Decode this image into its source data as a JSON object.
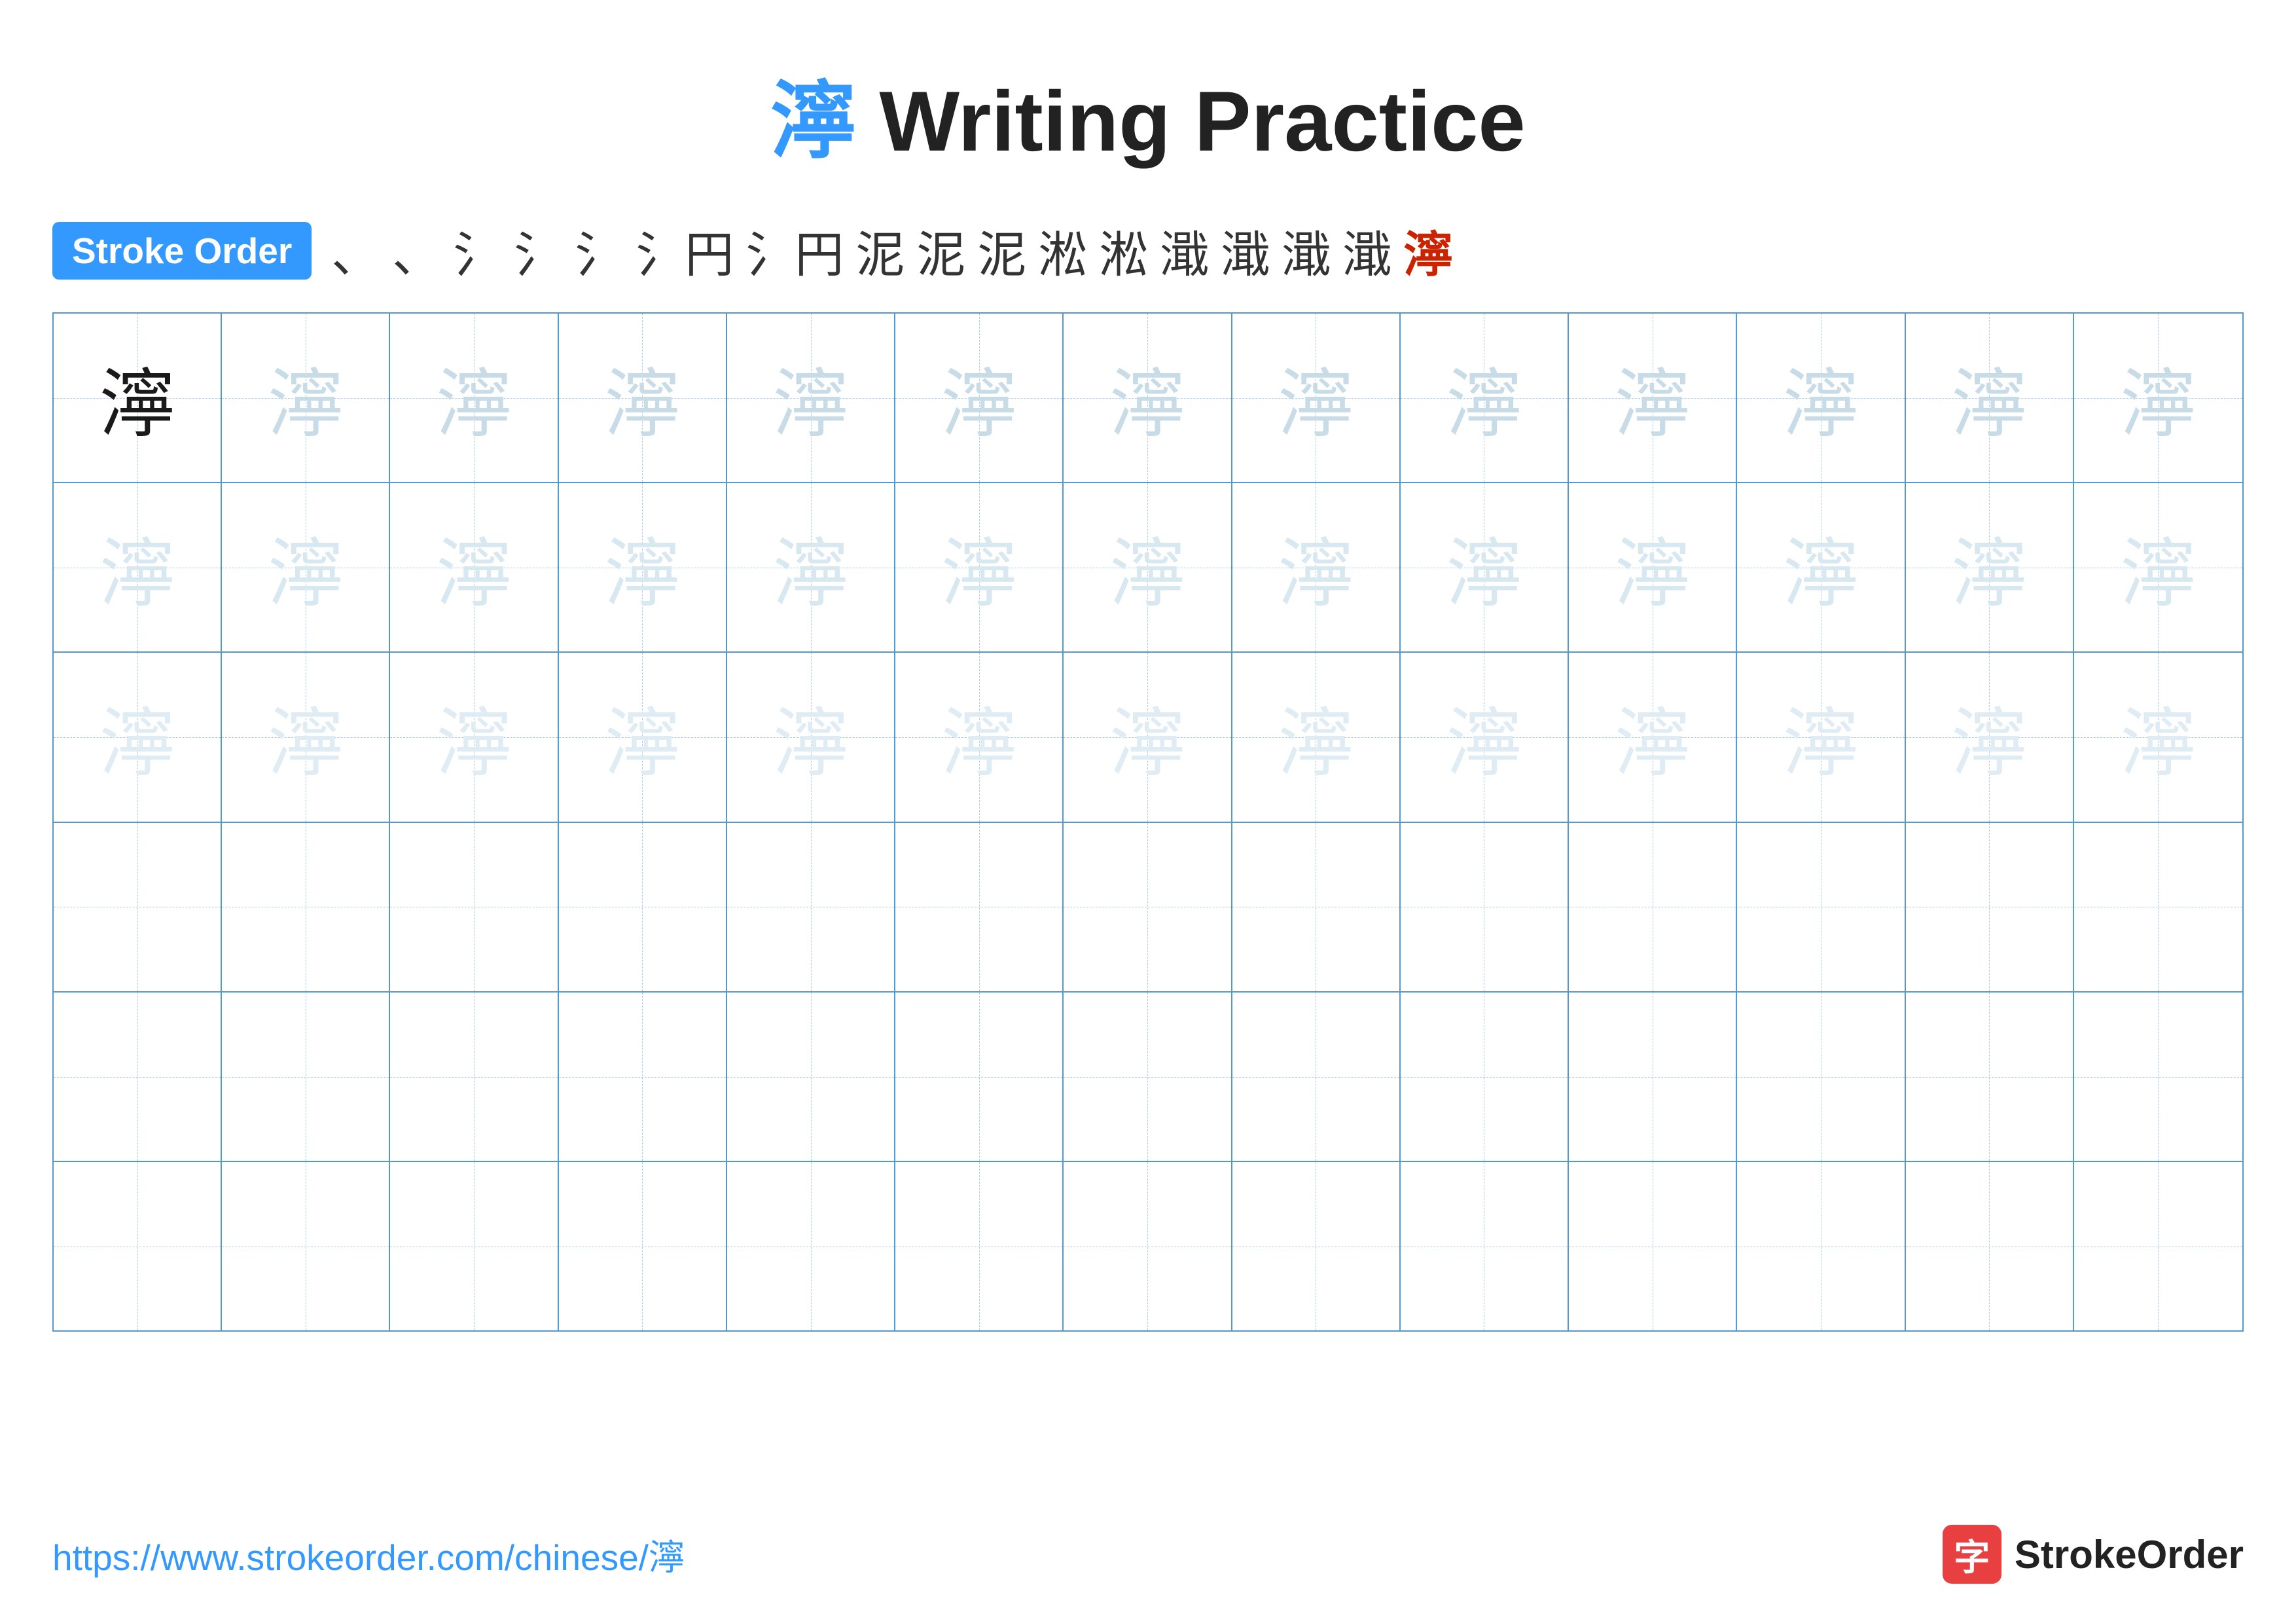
{
  "title": {
    "char": "濘",
    "text": " Writing Practice"
  },
  "stroke_order": {
    "badge_label": "Stroke Order",
    "steps": [
      "、",
      "、",
      "氵",
      "氵",
      "氵",
      "氵",
      "氵",
      "泥",
      "泥",
      "泥",
      "淖",
      "淖",
      "濘",
      "濘",
      "濘",
      "濘",
      "濘"
    ]
  },
  "grid": {
    "character": "濘",
    "rows": 6,
    "cols": 13
  },
  "footer": {
    "url": "https://www.strokeorder.com/chinese/濘",
    "logo_char": "字",
    "logo_text": "StrokeOrder"
  }
}
